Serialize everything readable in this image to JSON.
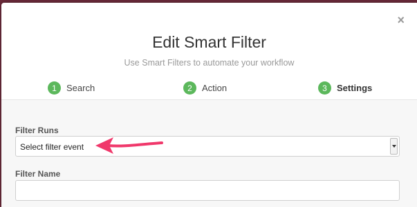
{
  "dialog": {
    "title": "Edit Smart Filter",
    "subtitle": "Use Smart Filters to automate your workflow",
    "close_glyph": "×"
  },
  "steps": [
    {
      "number": "1",
      "label": "Search",
      "active": false
    },
    {
      "number": "2",
      "label": "Action",
      "active": false
    },
    {
      "number": "3",
      "label": "Settings",
      "active": true
    }
  ],
  "form": {
    "filter_runs": {
      "label": "Filter Runs",
      "value": "Select filter event"
    },
    "filter_name": {
      "label": "Filter Name",
      "value": ""
    }
  },
  "colors": {
    "step_badge": "#5cb85c",
    "annotation_arrow": "#f0386b",
    "backdrop": "#6b2a3a"
  },
  "icons": {
    "close": "close-icon",
    "select_caret": "chevron-down-icon",
    "annotation": "arrow-left-icon"
  }
}
